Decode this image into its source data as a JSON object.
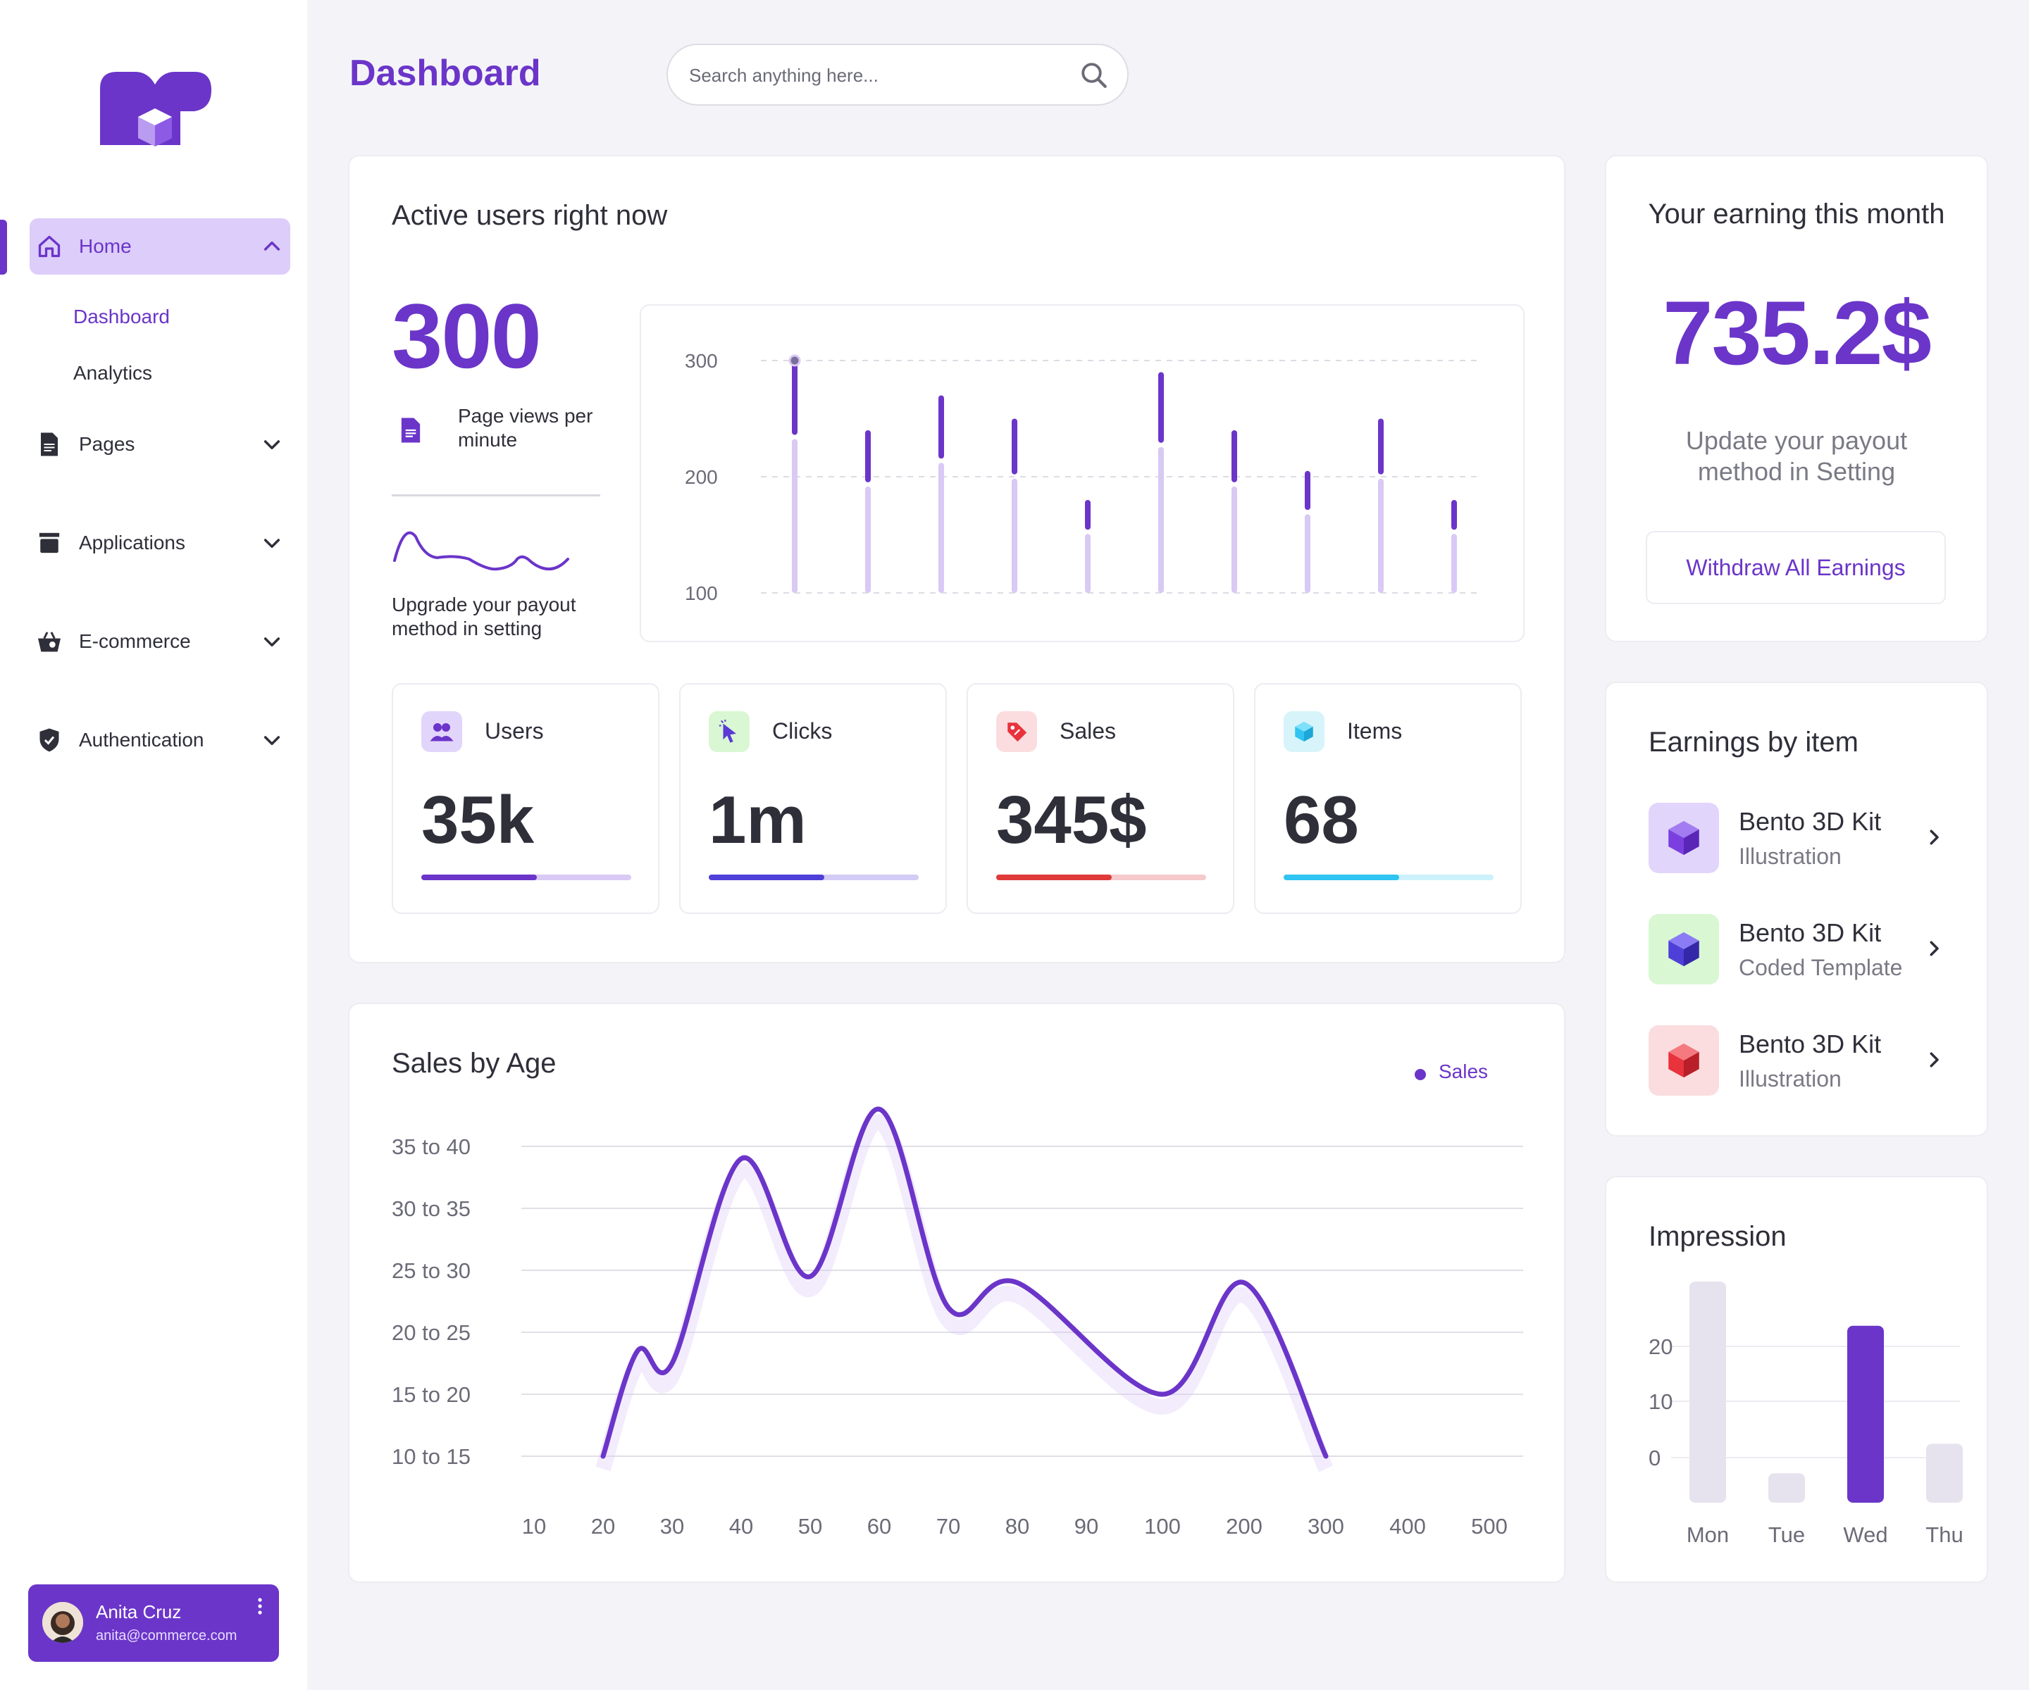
{
  "colors": {
    "primary": "#6b35c9",
    "primary_light": "#dccdfa",
    "bar_light": "#d9c9f5",
    "background": "#f4f4f8"
  },
  "sidebar": {
    "logo_icon": "m-logo-icon",
    "home": {
      "label": "Home",
      "icon": "home-icon"
    },
    "subitems": [
      {
        "label": "Dashboard"
      },
      {
        "label": "Analytics"
      }
    ],
    "items": [
      {
        "label": "Pages",
        "icon": "file-icon"
      },
      {
        "label": "Applications",
        "icon": "archive-icon"
      },
      {
        "label": "E-commerce",
        "icon": "basket-icon"
      },
      {
        "label": "Authentication",
        "icon": "shield-icon"
      }
    ],
    "user": {
      "name": "Anita Cruz",
      "email": "anita@commerce.com"
    }
  },
  "header": {
    "title": "Dashboard",
    "search_placeholder": "Search anything here..."
  },
  "active_users": {
    "title": "Active users right now",
    "count": "300",
    "page_views_label": "Page views per minute",
    "upgrade_text": "Upgrade your payout method in setting",
    "chart_data": {
      "type": "bar",
      "title": "",
      "ylim": [
        100,
        300
      ],
      "yticks": [
        "300",
        "200",
        "100"
      ],
      "series": [
        {
          "values": [
            300,
            240,
            270,
            250,
            180,
            290,
            240,
            205,
            250,
            180
          ]
        }
      ]
    }
  },
  "stats": [
    {
      "label": "Users",
      "value": "35k",
      "icon": "users-icon",
      "progress": 0.55,
      "color": "#6b35c9",
      "track": "#d9c9f5",
      "icon_bg": "#e2d5fb"
    },
    {
      "label": "Clicks",
      "value": "1m",
      "icon": "cursor-icon",
      "progress": 0.55,
      "color": "#4f3fd9",
      "track": "#d2ccf6",
      "icon_bg": "#d8f7d2"
    },
    {
      "label": "Sales",
      "value": "345$",
      "icon": "tag-icon",
      "progress": 0.55,
      "color": "#e03a3a",
      "track": "#f6c9cc",
      "icon_bg": "#fbdddf"
    },
    {
      "label": "Items",
      "value": "68",
      "icon": "cube-icon",
      "progress": 0.55,
      "color": "#2fc4f2",
      "track": "#cdf1fb",
      "icon_bg": "#d8f4fb"
    }
  ],
  "earning": {
    "title": "Your earning this month",
    "value": "735.2$",
    "subtitle": "Update your payout method in Setting",
    "button": "Withdraw All Earnings"
  },
  "earnings_by_item": {
    "title": "Earnings by item",
    "items": [
      {
        "name": "Bento 3D Kit",
        "sub": "Illustration",
        "icon": "cube-purple-icon",
        "bg": "#e2d5fb",
        "color": "#7b3fe0"
      },
      {
        "name": "Bento 3D Kit",
        "sub": "Coded Template",
        "icon": "cube-blue-icon",
        "bg": "#d8f7d2",
        "color": "#4f3fd9"
      },
      {
        "name": "Bento 3D Kit",
        "sub": "Illustration",
        "icon": "cube-red-icon",
        "bg": "#fbdddf",
        "color": "#e8323c"
      }
    ]
  },
  "sales_by_age": {
    "title": "Sales by Age",
    "legend": "Sales",
    "chart_data": {
      "type": "line",
      "title": "",
      "x_labels": [
        "10",
        "20",
        "30",
        "40",
        "50",
        "60",
        "70",
        "80",
        "90",
        "100",
        "200",
        "300",
        "400",
        "500"
      ],
      "y_labels": [
        "35 to 40",
        "30 to 35",
        "25 to 30",
        "20 to 25",
        "15 to 20",
        "10 to 15"
      ],
      "series": [
        {
          "name": "Sales",
          "points": [
            [
              20,
              10
            ],
            [
              25,
              18.5
            ],
            [
              30,
              17.5
            ],
            [
              40,
              34
            ],
            [
              50,
              24.5
            ],
            [
              60,
              38
            ],
            [
              70,
              22
            ],
            [
              80,
              24
            ],
            [
              100,
              15
            ],
            [
              200,
              24
            ],
            [
              300,
              10
            ]
          ]
        }
      ],
      "grid": true,
      "legend_position": "top-right"
    }
  },
  "impression": {
    "title": "Impression",
    "chart_data": {
      "type": "bar",
      "title": "",
      "categories": [
        "Mon",
        "Tue",
        "Wed",
        "Thu"
      ],
      "values": [
        30,
        4,
        24,
        8
      ],
      "yticks": [
        "20",
        "10",
        "0"
      ],
      "highlight": "Wed"
    }
  }
}
